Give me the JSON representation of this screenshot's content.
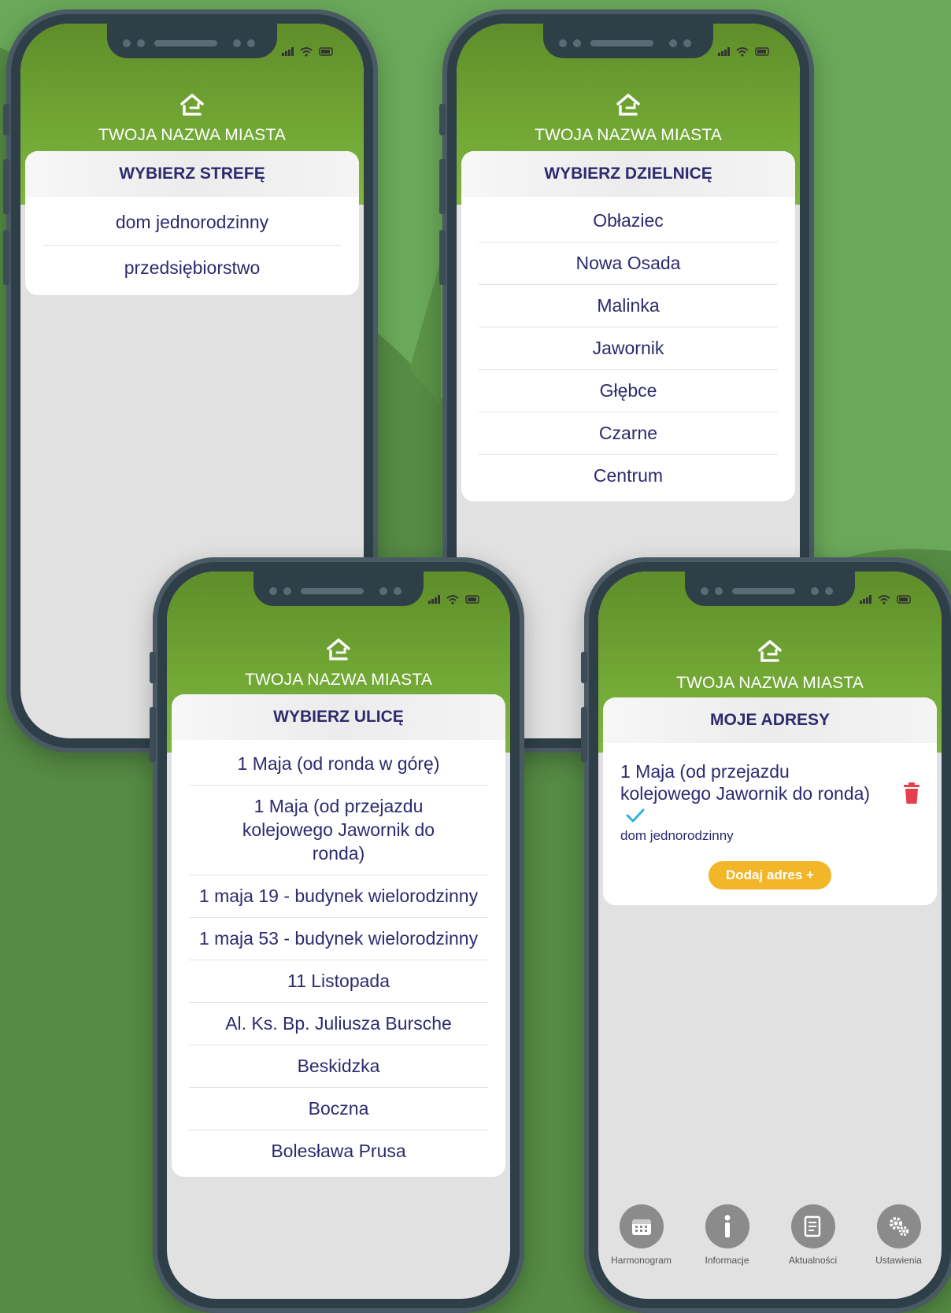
{
  "app": {
    "city_name": "TWOJA NAZWA MIASTA"
  },
  "colors": {
    "background": "#558b44",
    "header_green": "#6fa433",
    "title_text": "#2d2a6e",
    "add_button": "#f2b628",
    "delete_icon": "#e73e4f",
    "check_icon": "#2fb1e6"
  },
  "screen_zone": {
    "title": "WYBIERZ STREFĘ",
    "items": [
      "dom jednorodzinny",
      "przedsiębiorstwo"
    ]
  },
  "screen_district": {
    "title": "WYBIERZ DZIELNICĘ",
    "items": [
      "Obłaziec",
      "Nowa Osada",
      "Malinka",
      "Jawornik",
      "Głębce",
      "Czarne",
      "Centrum"
    ]
  },
  "screen_street": {
    "title": "WYBIERZ ULICĘ",
    "items": [
      "1 Maja (od ronda w górę)",
      "1 Maja (od przejazdu kolejowego Jawornik do ronda)",
      "1 maja 19 - budynek wielorodzinny",
      "1 maja 53 - budynek wielorodzinny",
      "11 Listopada",
      "Al. Ks. Bp. Juliusza Bursche",
      "Beskidzka",
      "Boczna",
      "Bolesława Prusa"
    ]
  },
  "screen_addresses": {
    "title": "MOJE ADRESY",
    "address": {
      "street": "1 Maja (od przejazdu kolejowego Jawornik do ronda)",
      "zone": "dom jednorodzinny",
      "check_icon": "check-icon",
      "delete_icon": "trash-icon"
    },
    "add_button": "Dodaj adres +",
    "nav": [
      {
        "label": "Harmonogram",
        "icon": "calendar-icon"
      },
      {
        "label": "Informacje",
        "icon": "info-icon"
      },
      {
        "label": "Aktualności",
        "icon": "news-icon"
      },
      {
        "label": "Ustawienia",
        "icon": "gears-icon"
      }
    ]
  }
}
